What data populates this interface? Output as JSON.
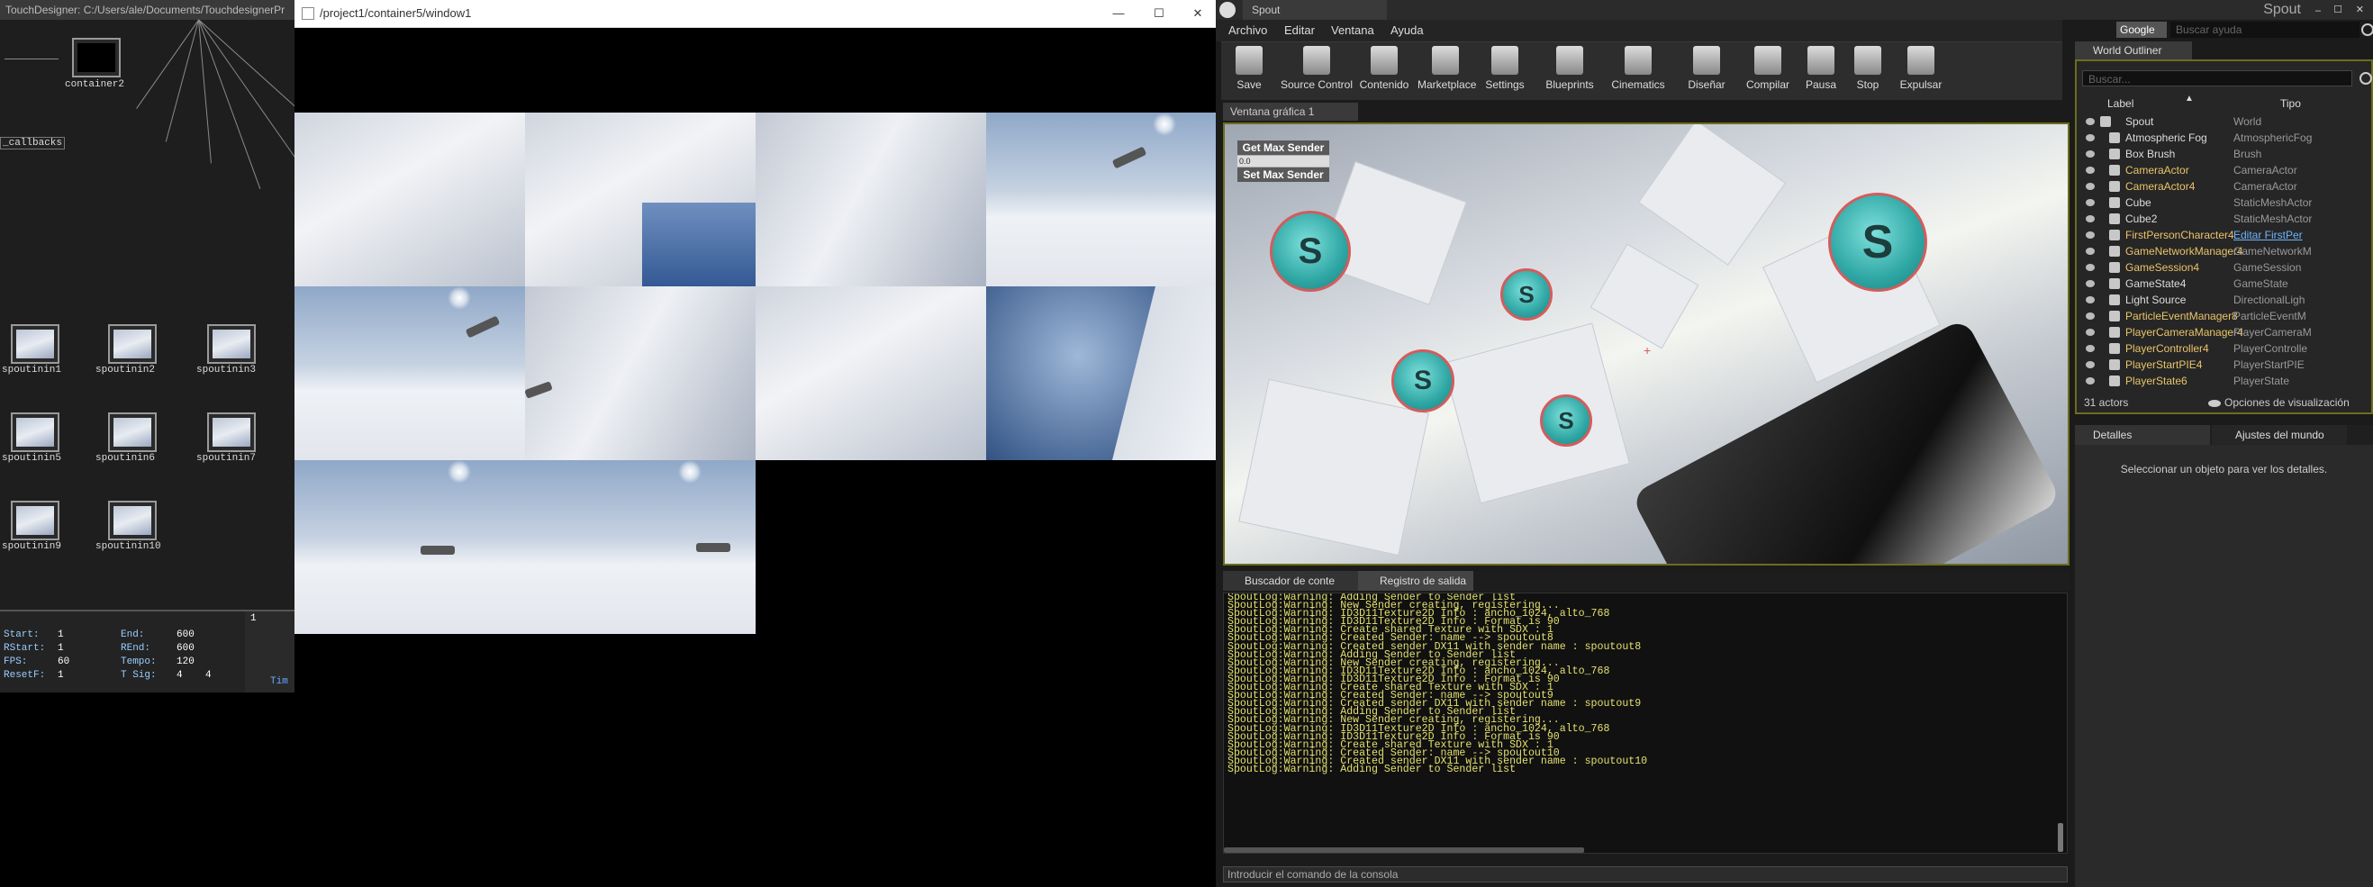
{
  "td": {
    "title": "TouchDesigner: C:/Users/ale/Documents/TouchdesignerPr",
    "container_label": "container2",
    "callbacks_label": "_callbacks",
    "nodes": [
      "spoutinin1",
      "spoutinin2",
      "spoutinin3",
      "spoutinin5",
      "spoutinin6",
      "spoutinin7",
      "spoutinin9",
      "spoutinin10"
    ],
    "timeline": {
      "start_label": "Start:",
      "start": "1",
      "end_label": "End:",
      "end": "600",
      "rstart_label": "RStart:",
      "rstart": "1",
      "rend_label": "REnd:",
      "rend": "600",
      "fps_label": "FPS:",
      "fps": "60",
      "tempo_label": "Tempo:",
      "tempo": "120",
      "resetf_label": "ResetF:",
      "resetf": "1",
      "tsig_label": "T Sig:",
      "tsig_a": "4",
      "tsig_b": "4",
      "frame": "1",
      "tim_label": "Tim"
    }
  },
  "grid_window": {
    "title": "/project1/container5/window1",
    "minimize_label": "—",
    "maximize_label": "☐",
    "close_label": "✕"
  },
  "ue": {
    "app_tab": "Spout",
    "menu": [
      "Archivo",
      "Editar",
      "Ventana",
      "Ayuda"
    ],
    "search_engine": "Google",
    "search_placeholder": "Buscar ayuda",
    "toolbar": [
      "Save",
      "Source Control",
      "Contenido",
      "Marketplace",
      "Settings",
      "Blueprints",
      "Cinematics",
      "Diseñar",
      "Compilar",
      "Pausa",
      "Stop",
      "Expulsar"
    ],
    "viewport_tab": "Ventana gráfica 1",
    "get_max_sender": "Get Max Sender",
    "max_value": "0.0",
    "set_max_sender": "Set Max Sender",
    "log_tabs": [
      "Buscador de conte",
      "Registro de salida"
    ],
    "log_lines": [
      "SpoutLog:Warning: Adding Sender to Sender list",
      "SpoutLog:Warning: New Sender creating, registering...",
      "SpoutLog:Warning: ID3D11Texture2D Info : ancho_1024, alto_768",
      "SpoutLog:Warning: ID3D11Texture2D Info : Format is 90",
      "SpoutLog:Warning: Create shared Texture with SDX : 1",
      "SpoutLog:Warning: Created Sender: name --> spoutout8",
      "SpoutLog:Warning: Created sender DX11 with sender name : spoutout8",
      "SpoutLog:Warning: Adding Sender to Sender list",
      "SpoutLog:Warning: New Sender creating, registering...",
      "SpoutLog:Warning: ID3D11Texture2D Info : ancho_1024, alto_768",
      "SpoutLog:Warning: ID3D11Texture2D Info : Format is 90",
      "SpoutLog:Warning: Create shared Texture with SDX : 1",
      "SpoutLog:Warning: Created Sender: name --> spoutout9",
      "SpoutLog:Warning: Created sender DX11 with sender name : spoutout9",
      "SpoutLog:Warning: Adding Sender to Sender list",
      "SpoutLog:Warning: New Sender creating, registering...",
      "SpoutLog:Warning: ID3D11Texture2D Info : ancho_1024, alto_768",
      "SpoutLog:Warning: ID3D11Texture2D Info : Format is 90",
      "SpoutLog:Warning: Create shared Texture with SDX : 1",
      "SpoutLog:Warning: Created Sender: name --> spoutout10",
      "SpoutLog:Warning: Created sender DX11 with sender name : spoutout10",
      "SpoutLog:Warning: Adding Sender to Sender list"
    ],
    "console_placeholder": "Introducir el comando de la consola",
    "outliner": {
      "tab": "World Outliner",
      "search_placeholder": "Buscar...",
      "col_label": "Label",
      "col_type": "Tipo",
      "rows": [
        {
          "label": "Spout",
          "type": "World"
        },
        {
          "label": "Atmospheric Fog",
          "type": "AtmosphericFog"
        },
        {
          "label": "Box Brush",
          "type": "Brush"
        },
        {
          "label": "CameraActor",
          "type": "CameraActor"
        },
        {
          "label": "CameraActor4",
          "type": "CameraActor"
        },
        {
          "label": "Cube",
          "type": "StaticMeshActor"
        },
        {
          "label": "Cube2",
          "type": "StaticMeshActor"
        },
        {
          "label": "FirstPersonCharacter4",
          "type": "Editar FirstPer"
        },
        {
          "label": "GameNetworkManager4",
          "type": "GameNetworkM"
        },
        {
          "label": "GameSession4",
          "type": "GameSession"
        },
        {
          "label": "GameState4",
          "type": "GameState"
        },
        {
          "label": "Light Source",
          "type": "DirectionalLigh"
        },
        {
          "label": "ParticleEventManager8",
          "type": "ParticleEventM"
        },
        {
          "label": "PlayerCameraManager4",
          "type": "PlayerCameraM"
        },
        {
          "label": "PlayerController4",
          "type": "PlayerControlle"
        },
        {
          "label": "PlayerStartPIE4",
          "type": "PlayerStartPIE"
        },
        {
          "label": "PlayerState6",
          "type": "PlayerState"
        }
      ],
      "actor_count": "31 actors",
      "view_options": "Opciones de visualización"
    },
    "details_tabs": [
      "Detalles",
      "Ajustes del mundo"
    ],
    "details_empty": "Seleccionar un objeto para ver los detalles.",
    "colors": {
      "label_yellow": "#e9c46a",
      "link_blue": "#6fb4ff",
      "log_text": "#e3e070"
    }
  }
}
